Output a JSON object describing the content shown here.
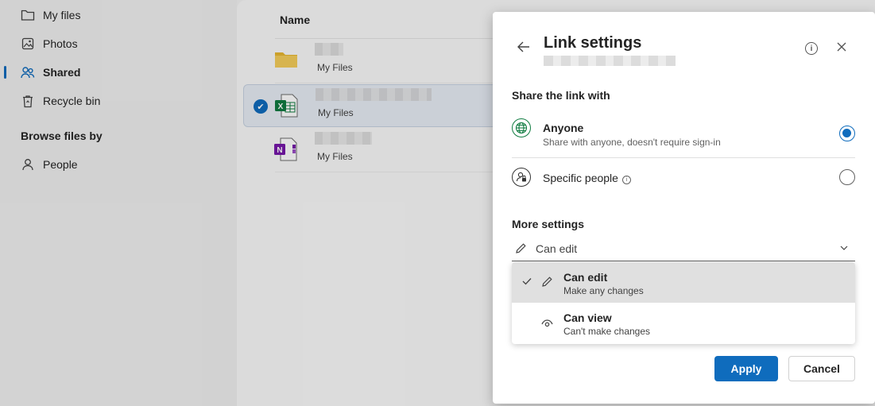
{
  "sidebar": {
    "items": [
      {
        "label": "My files",
        "icon": "folder-icon"
      },
      {
        "label": "Photos",
        "icon": "photo-icon"
      },
      {
        "label": "Shared",
        "icon": "people-icon"
      },
      {
        "label": "Recycle bin",
        "icon": "trash-icon"
      }
    ],
    "browse_heading": "Browse files by",
    "browse_items": [
      {
        "label": "People",
        "icon": "person-icon"
      }
    ]
  },
  "file_list": {
    "column_name": "Name",
    "rows": [
      {
        "location": "My Files",
        "type": "folder"
      },
      {
        "location": "My Files",
        "type": "excel"
      },
      {
        "location": "My Files",
        "type": "onenote"
      }
    ]
  },
  "dialog": {
    "title": "Link settings",
    "share_with_heading": "Share the link with",
    "options": [
      {
        "label": "Anyone",
        "description": "Share with anyone, doesn't require sign-in",
        "selected": true
      },
      {
        "label": "Specific people",
        "selected": false
      }
    ],
    "more_settings_heading": "More settings",
    "permission_dropdown": {
      "value": "Can edit",
      "options": [
        {
          "label": "Can edit",
          "description": "Make any changes",
          "selected": true
        },
        {
          "label": "Can view",
          "description": "Can't make changes",
          "selected": false
        }
      ]
    },
    "apply_label": "Apply",
    "cancel_label": "Cancel"
  },
  "colors": {
    "accent": "#0f6cbd",
    "excel": "#107c41",
    "onenote": "#7719aa",
    "folder": "#f2c94c"
  }
}
